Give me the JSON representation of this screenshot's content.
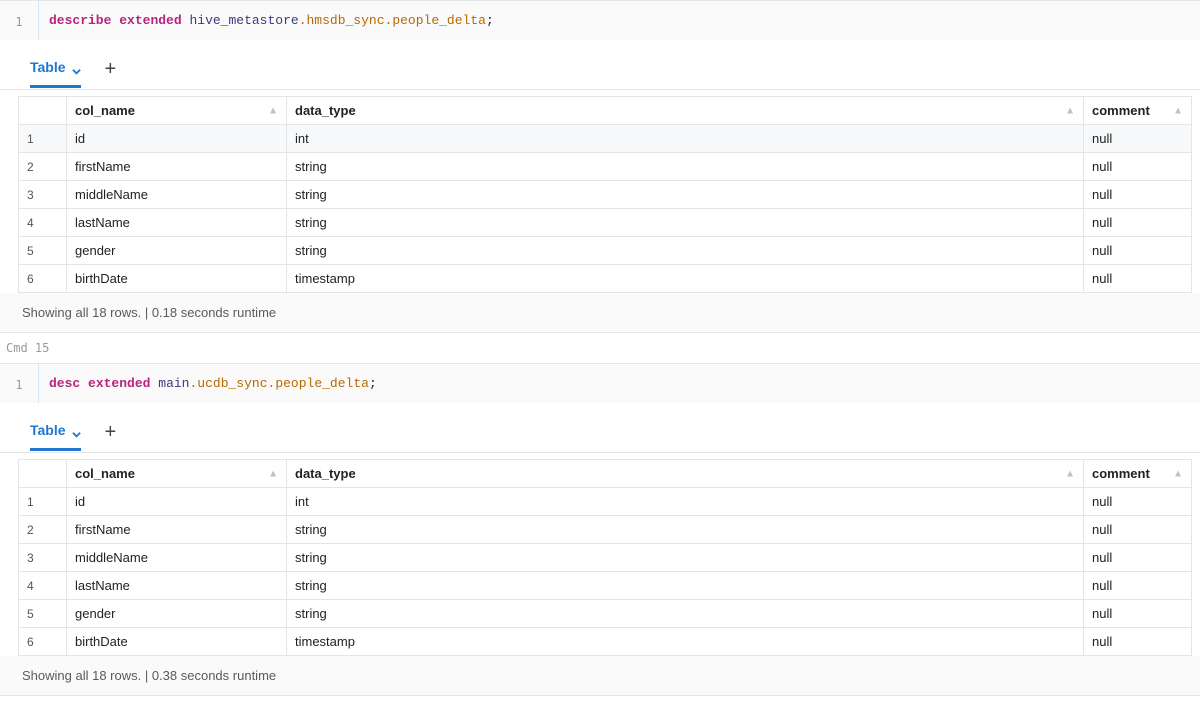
{
  "cell1": {
    "lineNo": "1",
    "code": {
      "kw1": "describe",
      "kw2": "extended",
      "ns": "hive_metastore",
      "db": "hmsdb_sync",
      "tbl": "people_delta"
    },
    "tab": "Table",
    "addTab": "+",
    "headers": {
      "col_name": "col_name",
      "data_type": "data_type",
      "comment": "comment"
    },
    "rows": [
      {
        "n": "1",
        "col_name": "id",
        "data_type": "int",
        "comment": "null"
      },
      {
        "n": "2",
        "col_name": "firstName",
        "data_type": "string",
        "comment": "null"
      },
      {
        "n": "3",
        "col_name": "middleName",
        "data_type": "string",
        "comment": "null"
      },
      {
        "n": "4",
        "col_name": "lastName",
        "data_type": "string",
        "comment": "null"
      },
      {
        "n": "5",
        "col_name": "gender",
        "data_type": "string",
        "comment": "null"
      },
      {
        "n": "6",
        "col_name": "birthDate",
        "data_type": "timestamp",
        "comment": "null"
      }
    ],
    "status": "Showing all 18 rows.  |  0.18 seconds runtime"
  },
  "cmdLabel": "Cmd 15",
  "cell2": {
    "lineNo": "1",
    "code": {
      "kw1": "desc",
      "kw2": "extended",
      "ns": "main",
      "db": "ucdb_sync",
      "tbl": "people_delta"
    },
    "tab": "Table",
    "addTab": "+",
    "headers": {
      "col_name": "col_name",
      "data_type": "data_type",
      "comment": "comment"
    },
    "rows": [
      {
        "n": "1",
        "col_name": "id",
        "data_type": "int",
        "comment": "null"
      },
      {
        "n": "2",
        "col_name": "firstName",
        "data_type": "string",
        "comment": "null"
      },
      {
        "n": "3",
        "col_name": "middleName",
        "data_type": "string",
        "comment": "null"
      },
      {
        "n": "4",
        "col_name": "lastName",
        "data_type": "string",
        "comment": "null"
      },
      {
        "n": "5",
        "col_name": "gender",
        "data_type": "string",
        "comment": "null"
      },
      {
        "n": "6",
        "col_name": "birthDate",
        "data_type": "timestamp",
        "comment": "null"
      }
    ],
    "status": "Showing all 18 rows.  |  0.38 seconds runtime"
  }
}
